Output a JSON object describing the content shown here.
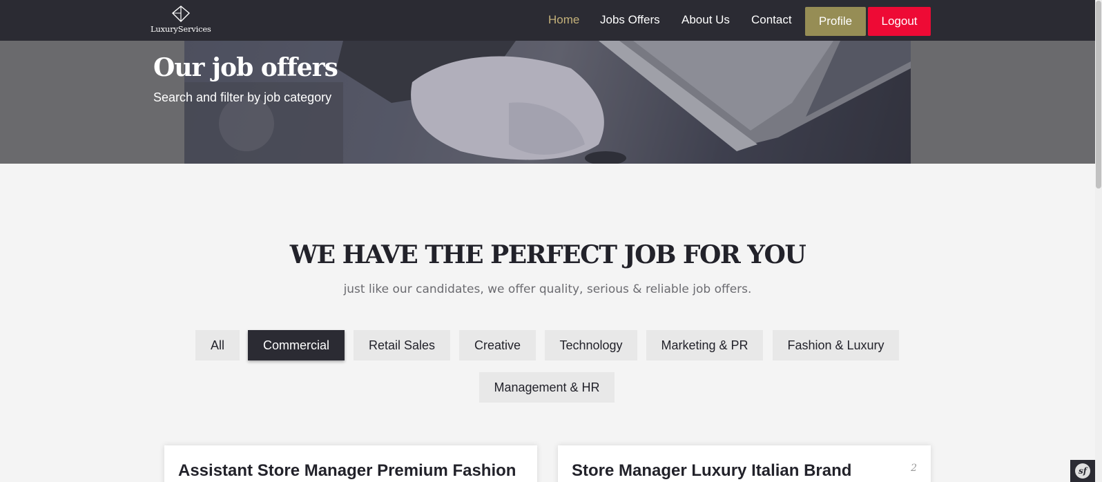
{
  "navbar": {
    "brand_name": "LuxuryServices",
    "links": [
      "Home",
      "Jobs Offers",
      "About Us",
      "Contact"
    ],
    "active_link": "Home",
    "profile_label": "Profile",
    "logout_label": "Logout",
    "colors": {
      "bg": "#2b2b33",
      "active": "#c4b17a",
      "profile": "#968d55",
      "logout": "#ee0a35"
    }
  },
  "hero": {
    "title": "Our job offers",
    "subtitle": "Search and filter by job category"
  },
  "section": {
    "title": "WE HAVE THE PERFECT JOB FOR YOU",
    "subtitle": "just like our candidates, we offer quality, serious & reliable job offers."
  },
  "filters": {
    "items": [
      "All",
      "Commercial",
      "Retail Sales",
      "Creative",
      "Technology",
      "Marketing & PR",
      "Fashion & Luxury",
      "Management & HR"
    ],
    "selected": "Commercial"
  },
  "cards": [
    {
      "title": "Assistant Store Manager Premium Fashion",
      "number": ""
    },
    {
      "title": "Store Manager Luxury Italian Brand",
      "number": "2"
    }
  ],
  "debug_toolbar": {
    "icon": "symfony-icon",
    "glyph": "sf"
  }
}
